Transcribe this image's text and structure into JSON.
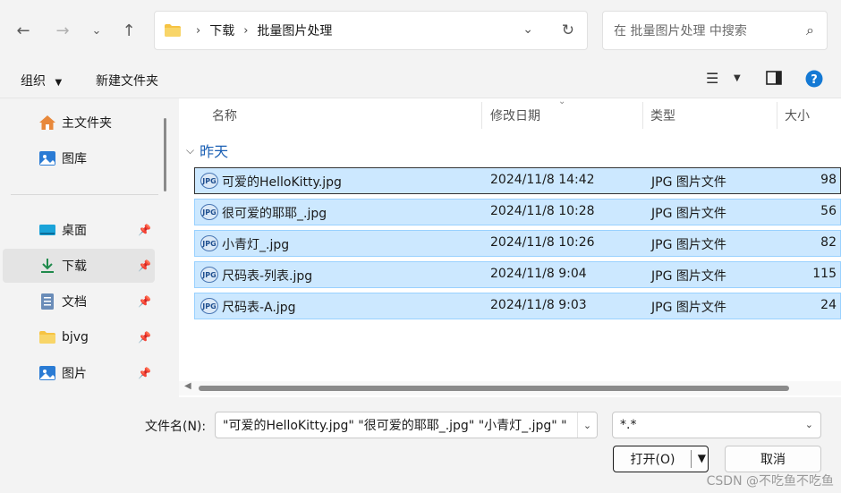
{
  "nav": {
    "back_icon": "back-arrow-icon",
    "forward_icon": "forward-arrow-icon",
    "recent_icon": "chevron-down-icon",
    "up_icon": "up-arrow-icon"
  },
  "address": {
    "crumbs": [
      "下载",
      "批量图片处理"
    ]
  },
  "search": {
    "placeholder": "在 批量图片处理 中搜索"
  },
  "toolbar": {
    "organize_label": "组织",
    "new_folder_label": "新建文件夹"
  },
  "sidebar": {
    "items": [
      {
        "label": "主文件夹",
        "icon": "home-icon"
      },
      {
        "label": "图库",
        "icon": "gallery-icon"
      },
      {
        "label": "桌面",
        "icon": "desktop-icon"
      },
      {
        "label": "下载",
        "icon": "download-icon"
      },
      {
        "label": "文档",
        "icon": "document-icon"
      },
      {
        "label": "bjvg",
        "icon": "folder-icon"
      },
      {
        "label": "图片",
        "icon": "pictures-icon"
      }
    ]
  },
  "columns": {
    "name": "名称",
    "date": "修改日期",
    "type": "类型",
    "size": "大小"
  },
  "group": {
    "label": "昨天"
  },
  "files": [
    {
      "name": "可爱的HelloKitty.jpg",
      "date": "2024/11/8 14:42",
      "type": "JPG 图片文件",
      "size": "98"
    },
    {
      "name": "很可爱的耶耶_.jpg",
      "date": "2024/11/8 10:28",
      "type": "JPG 图片文件",
      "size": "56"
    },
    {
      "name": "小青灯_.jpg",
      "date": "2024/11/8 10:26",
      "type": "JPG 图片文件",
      "size": "82"
    },
    {
      "name": "尺码表-列表.jpg",
      "date": "2024/11/8 9:04",
      "type": "JPG 图片文件",
      "size": "115"
    },
    {
      "name": "尺码表-A.jpg",
      "date": "2024/11/8 9:03",
      "type": "JPG 图片文件",
      "size": "24"
    }
  ],
  "file_icon_text": "JPG",
  "bottom": {
    "filename_label": "文件名(N):",
    "filename_value": "\"可爱的HelloKitty.jpg\" \"很可爱的耶耶_.jpg\" \"小青灯_.jpg\" \"",
    "filetype_value": "*.*",
    "open_label": "打开(O)",
    "cancel_label": "取消"
  },
  "watermark": "CSDN @不吃鱼不吃鱼"
}
